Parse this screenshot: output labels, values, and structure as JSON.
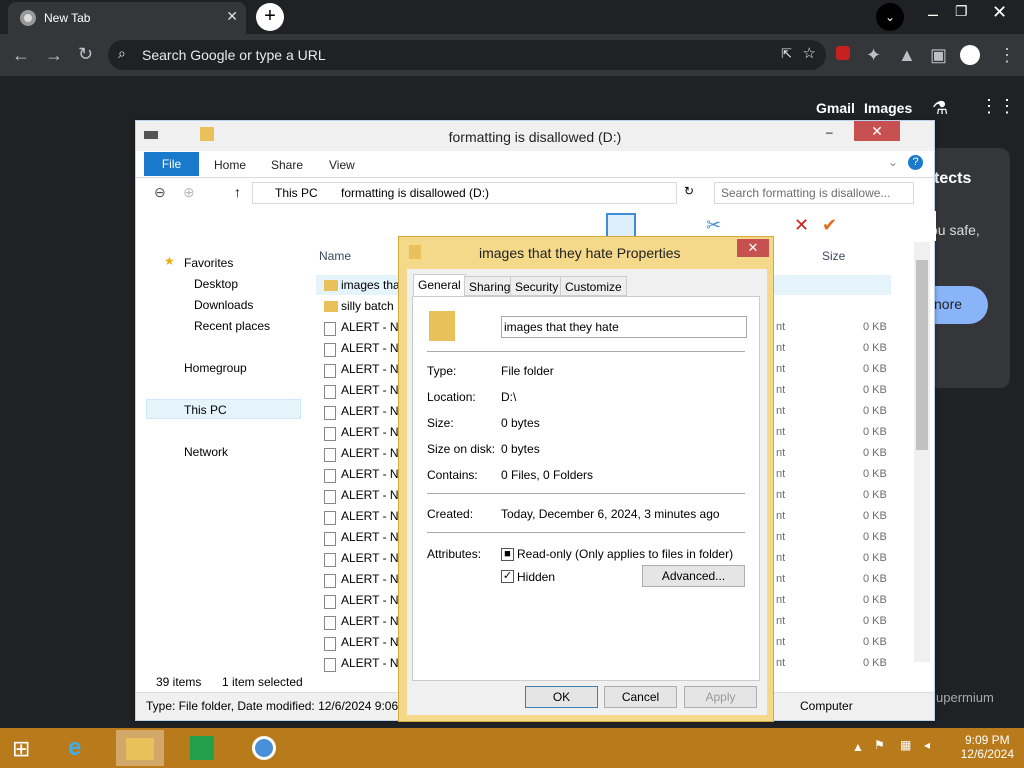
{
  "browser": {
    "tab_title": "New Tab",
    "omnibox_placeholder": "Search Google or type a URL",
    "ntp_links": [
      "Gmail",
      "Images"
    ]
  },
  "explorer": {
    "title": "formatting is disallowed (D:)",
    "ribbon_tabs": [
      "File",
      "Home",
      "Share",
      "View"
    ],
    "breadcrumb": [
      "This PC",
      "formatting is disallowed (D:)"
    ],
    "search_placeholder": "Search formatting is disallowe...",
    "columns": [
      "Name",
      "Size"
    ],
    "nav": {
      "favorites": "Favorites",
      "items": [
        "Desktop",
        "Downloads",
        "Recent places"
      ],
      "homegroup": "Homegroup",
      "thispc": "This PC",
      "network": "Network"
    },
    "rows": [
      {
        "name": "images tha",
        "size": "",
        "kind": "folder"
      },
      {
        "name": "silly batch",
        "size": "",
        "kind": "folder"
      },
      {
        "name": "ALERT - NC",
        "size": "0 KB",
        "kind": "file"
      },
      {
        "name": "ALERT - NC",
        "size": "0 KB",
        "kind": "file"
      },
      {
        "name": "ALERT - NC",
        "size": "0 KB",
        "kind": "file"
      },
      {
        "name": "ALERT - NC",
        "size": "0 KB",
        "kind": "file"
      },
      {
        "name": "ALERT - NC",
        "size": "0 KB",
        "kind": "file"
      },
      {
        "name": "ALERT - NC",
        "size": "0 KB",
        "kind": "file"
      },
      {
        "name": "ALERT - NC",
        "size": "0 KB",
        "kind": "file"
      },
      {
        "name": "ALERT - NC",
        "size": "0 KB",
        "kind": "file"
      },
      {
        "name": "ALERT - NC",
        "size": "0 KB",
        "kind": "file"
      },
      {
        "name": "ALERT - NC",
        "size": "0 KB",
        "kind": "file"
      },
      {
        "name": "ALERT - NC",
        "size": "0 KB",
        "kind": "file"
      },
      {
        "name": "ALERT - NC",
        "size": "0 KB",
        "kind": "file"
      },
      {
        "name": "ALERT - NC",
        "size": "0 KB",
        "kind": "file"
      },
      {
        "name": "ALERT - NC",
        "size": "0 KB",
        "kind": "file"
      },
      {
        "name": "ALERT - NC",
        "size": "0 KB",
        "kind": "file"
      },
      {
        "name": "ALERT - NC",
        "size": "0 KB",
        "kind": "file"
      },
      {
        "name": "ALERT - NC",
        "size": "0 KB",
        "kind": "file"
      }
    ],
    "kind_suffix": "nt",
    "status_items": "39 items",
    "status_selected": "1 item selected",
    "statusbar": "Type: File folder, Date modified: 12/6/2024 9:06 P",
    "statusbar_right": "Computer"
  },
  "dialog": {
    "title": "images that they hate Properties",
    "tabs": [
      "General",
      "Sharing",
      "Security",
      "Customize"
    ],
    "name_value": "images that they hate",
    "fields": [
      {
        "label": "Type:",
        "value": "File folder"
      },
      {
        "label": "Location:",
        "value": "D:\\"
      },
      {
        "label": "Size:",
        "value": "0 bytes"
      },
      {
        "label": "Size on disk:",
        "value": "0 bytes"
      },
      {
        "label": "Contains:",
        "value": "0 Files, 0 Folders"
      }
    ],
    "created_label": "Created:",
    "created_value": "Today, December 6, 2024, 3 minutes ago",
    "attributes_label": "Attributes:",
    "readonly_label": "Read-only (Only applies to files in folder)",
    "hidden_label": "Hidden",
    "advanced_label": "Advanced...",
    "ok": "OK",
    "cancel": "Cancel",
    "apply": "Apply"
  },
  "ntp_bg_text": [
    "tects",
    "ou safe,",
    "nore",
    "upermium"
  ],
  "clock": {
    "time": "9:09 PM",
    "date": "12/6/2024"
  }
}
